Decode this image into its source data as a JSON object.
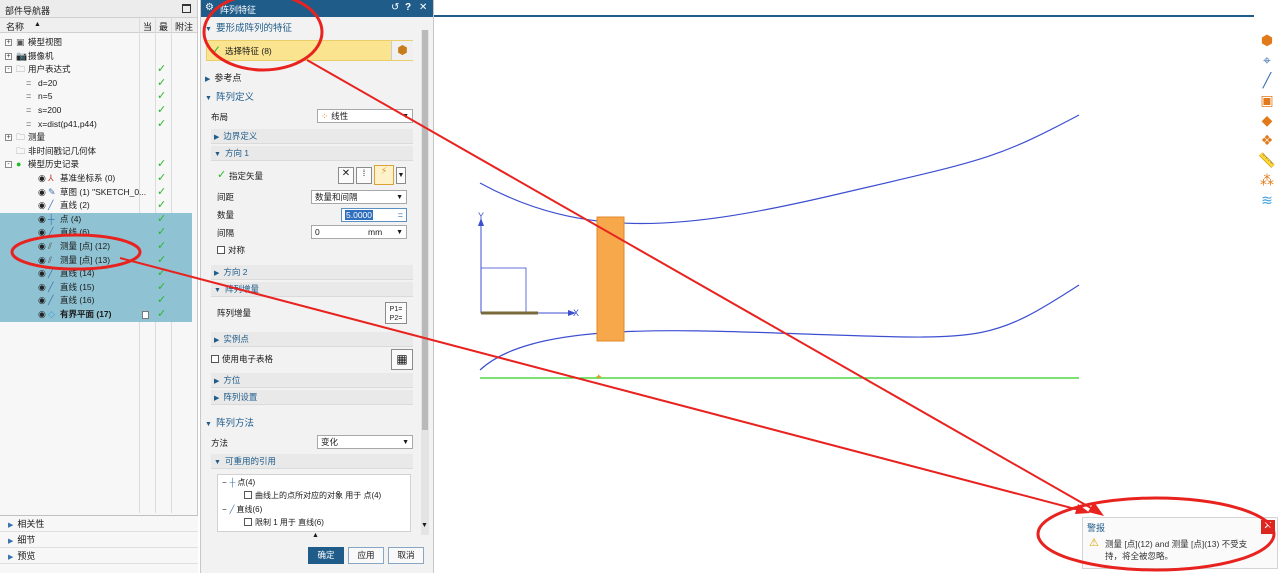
{
  "navigator": {
    "title": "部件导航器",
    "columns": {
      "name": "名称",
      "current": "当",
      "latest": "最",
      "note": "附注"
    },
    "rows": [
      {
        "label": "模型视图",
        "icon": "model-view-icon",
        "toggle": "+",
        "check": false
      },
      {
        "label": "摄像机",
        "icon": "camera-icon",
        "toggle": "+",
        "check": false
      },
      {
        "label": "用户表达式",
        "icon": "folder-icon",
        "toggle": "-",
        "check": true
      },
      {
        "label": "d=20",
        "icon": "equals-icon",
        "check": true
      },
      {
        "label": "n=5",
        "icon": "equals-icon",
        "check": true
      },
      {
        "label": "s=200",
        "icon": "equals-icon",
        "check": true
      },
      {
        "label": "x=dist(p41,p44)",
        "icon": "equals-icon",
        "check": true
      },
      {
        "label": "测量",
        "icon": "folder-icon",
        "toggle": "+",
        "check": false
      },
      {
        "label": "非时间戳记几何体",
        "icon": "folder-icon",
        "check": false
      },
      {
        "label": "模型历史记录",
        "icon": "history-icon",
        "toggle": "-",
        "check": true
      },
      {
        "label": "基准坐标系 (0)",
        "icon": "datum-csys-icon",
        "check": true
      },
      {
        "label": "草图 (1) \"SKETCH_0...",
        "icon": "sketch-icon",
        "check": true
      },
      {
        "label": "直线 (2)",
        "icon": "line-icon",
        "check": true
      },
      {
        "label": "点 (4)",
        "icon": "point-icon",
        "check": true,
        "selected": true
      },
      {
        "label": "直线 (6)",
        "icon": "line-icon",
        "check": true,
        "selected": true
      },
      {
        "label": "测量 [点] (12)",
        "icon": "measure-icon",
        "check": true,
        "selected": true
      },
      {
        "label": "测量 [点] (13)",
        "icon": "measure-icon",
        "check": true,
        "selected": true
      },
      {
        "label": "直线 (14)",
        "icon": "line-icon",
        "check": true,
        "selected": true
      },
      {
        "label": "直线 (15)",
        "icon": "line-icon",
        "check": true,
        "selected": true
      },
      {
        "label": "直线 (16)",
        "icon": "line-icon",
        "check": true,
        "selected": true
      },
      {
        "label": "有界平面 (17)",
        "icon": "bounded-plane-icon",
        "check": true,
        "selected": true,
        "bold": true
      }
    ],
    "bottom": {
      "dependencies": "相关性",
      "details": "细节",
      "preview": "预览"
    }
  },
  "dialog": {
    "title": "阵列特征",
    "sec_features": "要形成阵列的特征",
    "select_features": "选择特征 (8)",
    "sec_reference": "参考点",
    "sec_array_def": "阵列定义",
    "layout_label": "布局",
    "layout_value": "线性",
    "sub_boundary": "边界定义",
    "sub_direction1": "方向 1",
    "specify_vector": "指定矢量",
    "spacing_label": "间距",
    "spacing_value": "数量和间隔",
    "count_label": "数量",
    "count_value": "5.0000",
    "pitch_label": "间隔",
    "pitch_value": "0",
    "pitch_unit": "mm",
    "symmetric": "对称",
    "sub_direction2": "方向 2",
    "sub_increment": "阵列增量",
    "increment_label": "阵列增量",
    "sub_instance": "实例点",
    "use_spreadsheet": "使用电子表格",
    "sub_orientation": "方位",
    "sub_settings": "阵列设置",
    "sec_method": "阵列方法",
    "method_label": "方法",
    "method_value": "变化",
    "sub_reusable": "可重用的引用",
    "tree": {
      "point": "点(4)",
      "point_child": "曲线上的点所对应的对象 用于 点(4)",
      "line": "直线(6)",
      "line_child": "限制 1 用于 直线(6)"
    },
    "buttons": {
      "ok": "确定",
      "apply": "应用",
      "cancel": "取消"
    }
  },
  "graphics": {
    "axis_x": "X",
    "axis_y": "Y",
    "colors": {
      "curve": "#3d4fd1",
      "green_line": "#2ad11f",
      "rect": "#f7a84b",
      "annotation": "#e8231f"
    }
  },
  "alert": {
    "title": "警报",
    "message": "测量 [点](12) and 测量 [点](13) 不受支持，将全被忽略。"
  }
}
